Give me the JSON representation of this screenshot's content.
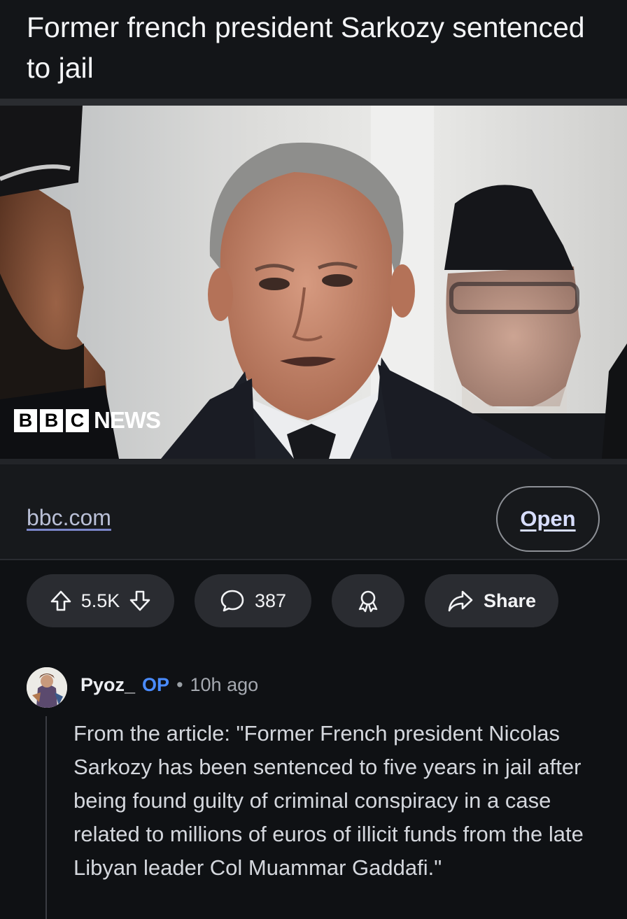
{
  "post": {
    "title": "Former french president Sarkozy sentenced to jail"
  },
  "image": {
    "logo": {
      "block1": "B",
      "block2": "B",
      "block3": "C",
      "news": "NEWS"
    }
  },
  "link": {
    "domain": "bbc.com",
    "open_label": "Open"
  },
  "actions": {
    "votes": "5.5K",
    "comments": "387",
    "share_label": "Share",
    "icons": {
      "upvote": "arrow-up-icon",
      "downvote": "arrow-down-icon",
      "comment": "speech-bubble-icon",
      "award": "award-ribbon-icon",
      "share": "share-arrow-icon"
    }
  },
  "comment": {
    "author": "Pyoz_",
    "op_badge": "OP",
    "separator": "•",
    "time": "10h ago",
    "text": "From the article: \"Former French president Nicolas Sarkozy has been sentenced to five years in jail after being found guilty of criminal conspiracy in a case related to millions of euros of illicit funds from the late Libyan leader Col Muammar Gaddafi.\""
  },
  "colors": {
    "background": "#0f1114",
    "pill": "#2a2c31",
    "op_blue": "#4a8cff",
    "link": "#b9bfd6"
  }
}
